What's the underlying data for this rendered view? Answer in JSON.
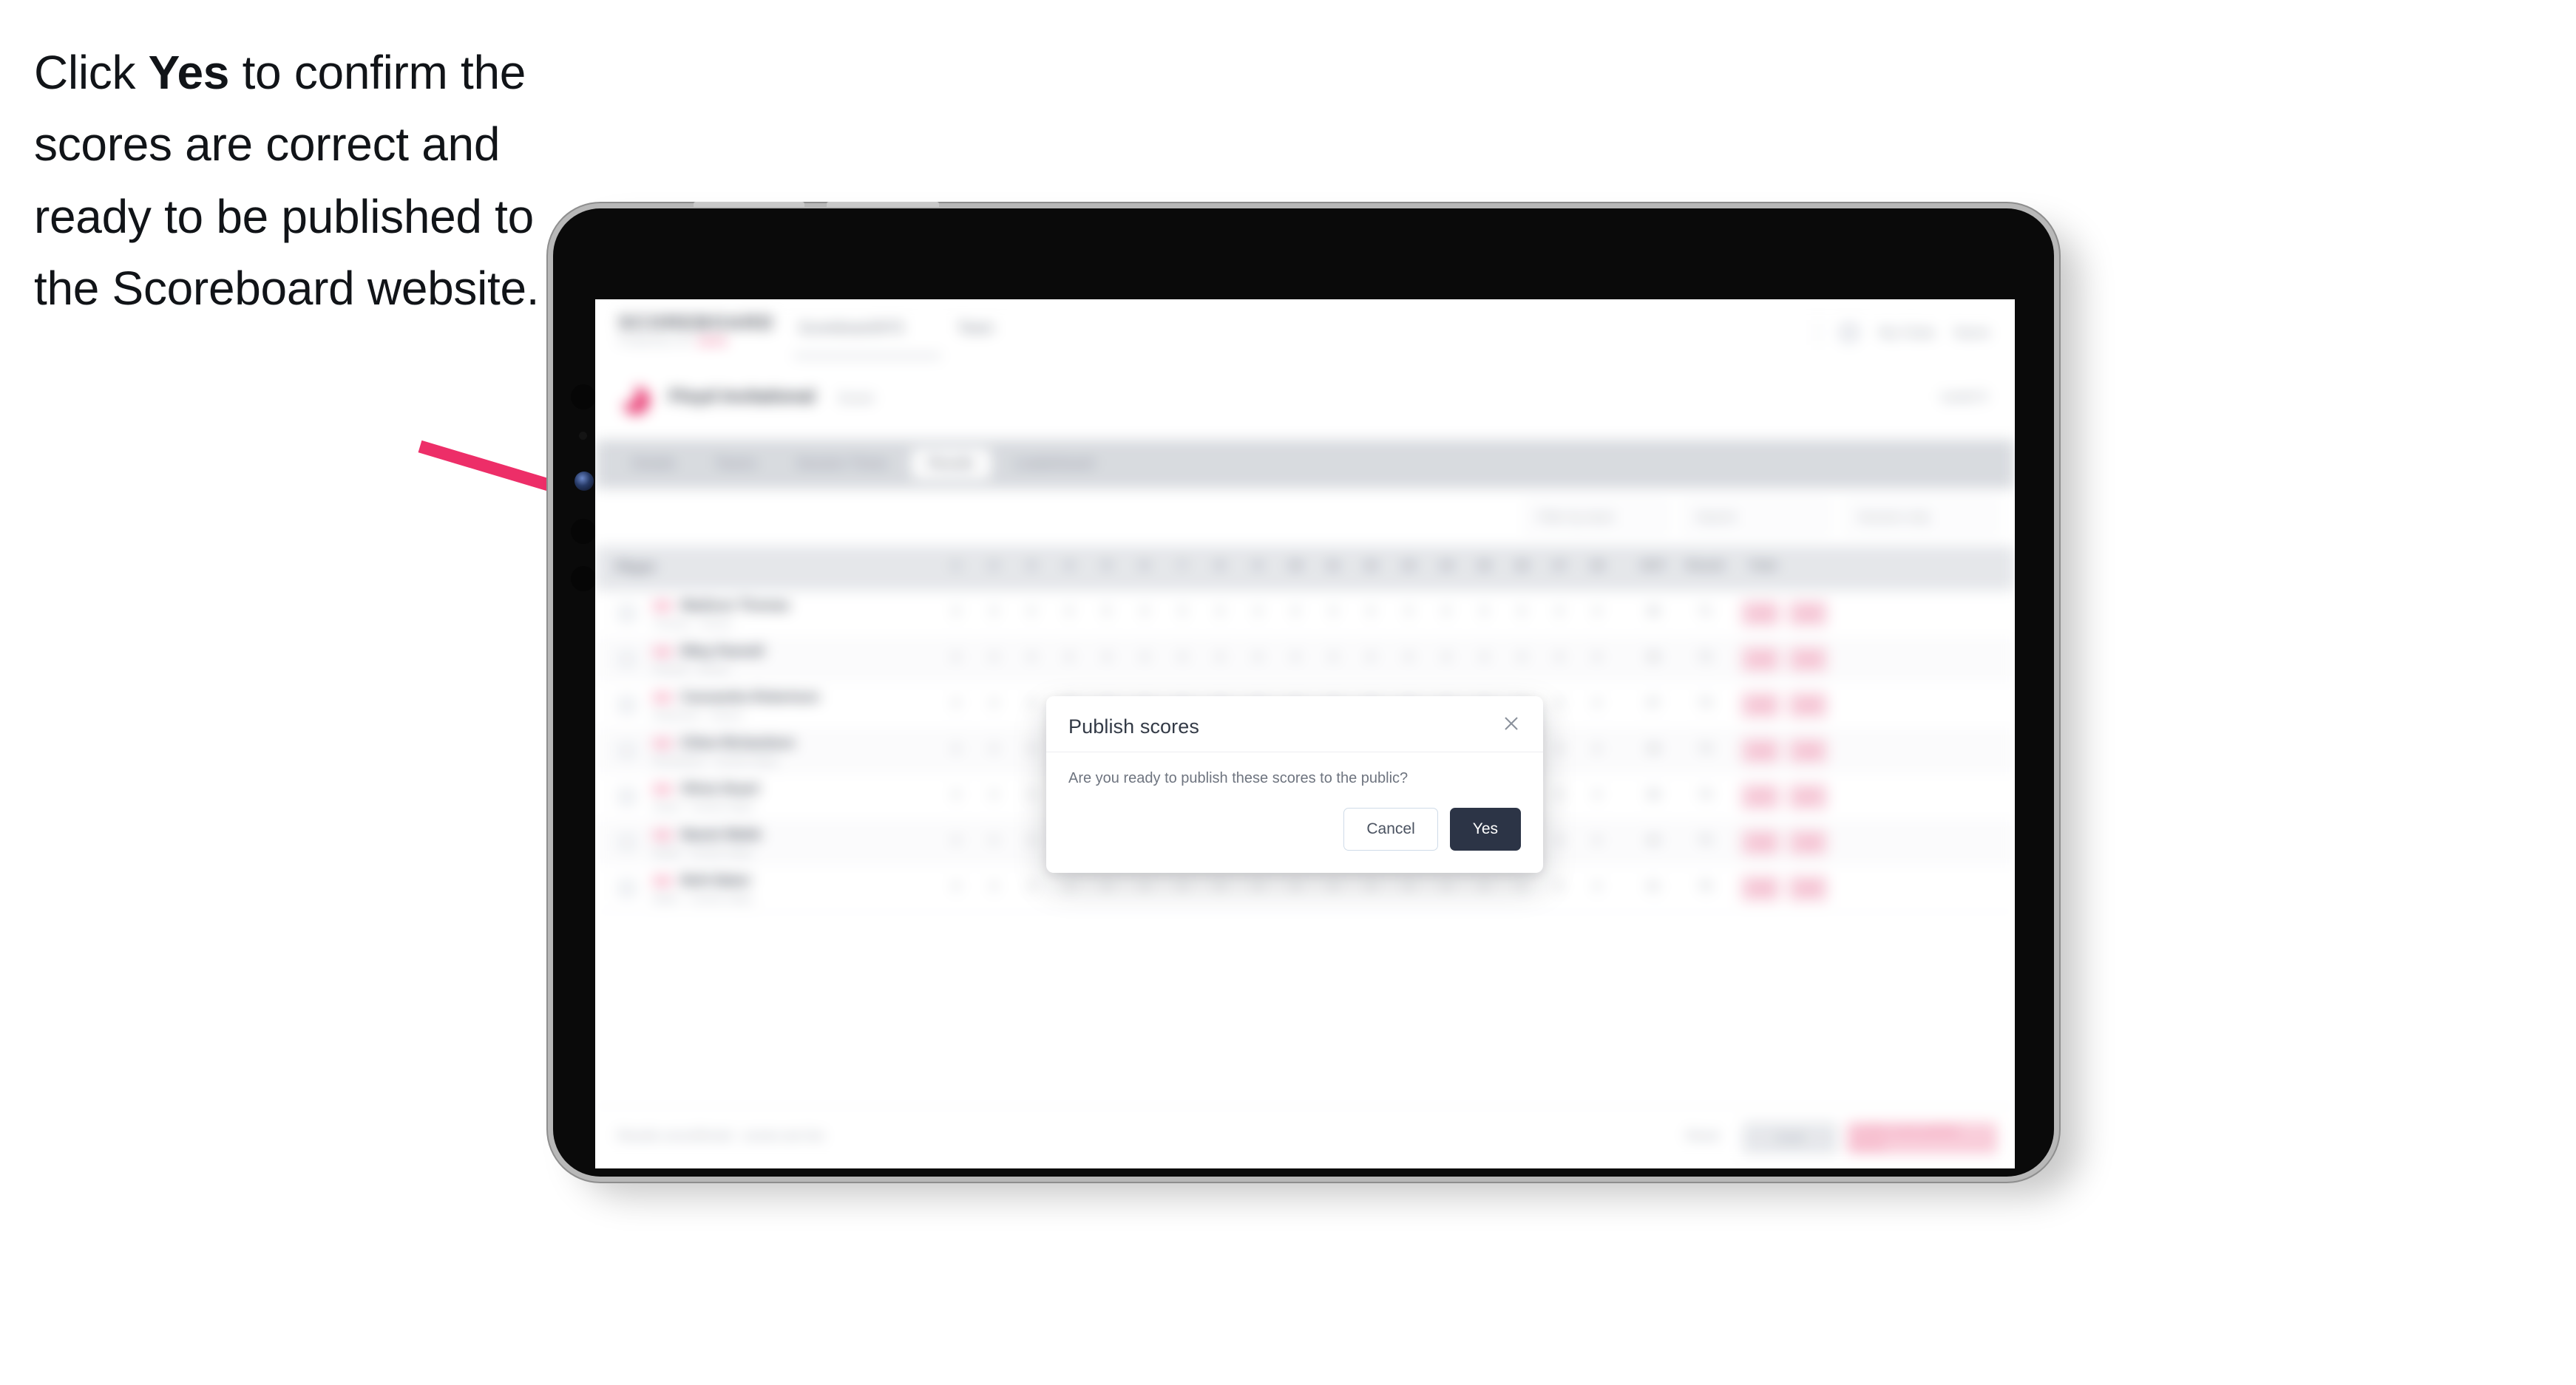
{
  "caption": {
    "lead": "Click ",
    "emphasis": "Yes",
    "rest": " to confirm the scores are correct and ready to be published to the Scoreboard website."
  },
  "annotation": {
    "arrow_color": "#ED2E68",
    "arrow_name": "pointer-arrow"
  },
  "device": {
    "type": "tablet",
    "frame_color": "#0a0a0a",
    "edge_color": "#b8b8b8"
  },
  "app": {
    "header": {
      "brand": "SCOREBOARD",
      "brand_sub_left": "POWERED BY",
      "brand_sub_accent": "SEEN",
      "nav": [
        "Scoreboard/975",
        "Team"
      ],
      "account": [
        "My Clubs",
        "Name"
      ]
    },
    "title_row": {
      "club_name": "Floyd Invitational",
      "tag": "Event",
      "right_meta": "Level 3"
    },
    "tabs": [
      {
        "label": "Details",
        "active": false
      },
      {
        "label": "Teams",
        "active": false
      },
      {
        "label": "Session Times",
        "active": false
      },
      {
        "label": "Results",
        "active": true
      },
      {
        "label": "Leaderboard",
        "active": false
      }
    ],
    "toolbar": {
      "filter": "Filter by team",
      "search": "Search",
      "select": "Session only"
    },
    "table": {
      "headers": [
        "Player",
        "1",
        "2",
        "3",
        "4",
        "5",
        "6",
        "7",
        "8",
        "9",
        "10",
        "11",
        "12",
        "13",
        "14",
        "15",
        "16",
        "17",
        "18",
        "OUT",
        "Round",
        "Total"
      ],
      "rows": [
        {
          "name": "Madison Thomas",
          "sub": "Thomas · School",
          "scores": [
            "4",
            "4",
            "4",
            "4",
            "5",
            "4",
            "3",
            "4",
            "4",
            "4",
            "4",
            "4",
            "3",
            "4",
            "4",
            "4",
            "4",
            "4"
          ],
          "out": "36",
          "round": "71",
          "total_a": "143",
          "total_b": "143"
        },
        {
          "name": "Riley Pannell",
          "sub": "Pannell · School",
          "scores": [
            "4",
            "4",
            "4",
            "4",
            "4",
            "4",
            "4",
            "4",
            "4",
            "4",
            "4",
            "4",
            "4",
            "4",
            "4",
            "4",
            "4",
            "4"
          ],
          "out": "36",
          "round": "72",
          "total_a": "144",
          "total_b": "144"
        },
        {
          "name": "Cassandra Robertson",
          "sub": "Robertson · School",
          "scores": [
            "4",
            "4",
            "4",
            "5",
            "4",
            "4",
            "4",
            "4",
            "4",
            "4",
            "4",
            "4",
            "4",
            "4",
            "4",
            "4",
            "4",
            "4"
          ],
          "out": "37",
          "round": "73",
          "total_a": "145",
          "total_b": "145"
        },
        {
          "name": "Chloe Richardson",
          "sub": "Richardson · Central Valley",
          "scores": [
            "4",
            "4",
            "4",
            "4",
            "4",
            "4",
            "4",
            "5",
            "4",
            "4",
            "4",
            "4",
            "4",
            "4",
            "4",
            "4",
            "4",
            "4"
          ],
          "out": "38",
          "round": "73",
          "total_a": "146",
          "total_b": "146"
        },
        {
          "name": "Olivia Stuart",
          "sub": "Stuart · Central Valley",
          "scores": [
            "4",
            "4",
            "4",
            "4",
            "4",
            "4",
            "4",
            "5",
            "4",
            "4",
            "4",
            "4",
            "4",
            "4",
            "4",
            "4",
            "4",
            "4"
          ],
          "out": "39",
          "round": "74",
          "total_a": "147",
          "total_b": "147"
        },
        {
          "name": "Naomi Webb",
          "sub": "Webb · Central Valley",
          "scores": [
            "4",
            "4",
            "4",
            "4",
            "4",
            "4",
            "4",
            "5",
            "4",
            "4",
            "4",
            "4",
            "4",
            "4",
            "4",
            "4",
            "4",
            "4"
          ],
          "out": "40",
          "round": "75",
          "total_a": "148",
          "total_b": "148"
        },
        {
          "name": "Beth Baker",
          "sub": "Baker · Central Valley",
          "scores": [
            "4",
            "4",
            "4",
            "4",
            "4",
            "4",
            "4",
            "5",
            "4",
            "4",
            "4",
            "4",
            "4",
            "4",
            "4",
            "4",
            "4",
            "4"
          ],
          "out": "41",
          "round": "76",
          "total_a": "149",
          "total_b": "149"
        }
      ]
    },
    "footer": {
      "note": "Results unconfirmed · scores are live",
      "link": "Reset",
      "draft_button": "Draft",
      "publish_button": "Confirm and publish scores"
    }
  },
  "modal": {
    "title": "Publish scores",
    "body": "Are you ready to publish these scores to the public?",
    "cancel_label": "Cancel",
    "confirm_label": "Yes",
    "close_icon": "close-icon",
    "confirm_color": "#2C3446",
    "cancel_border": "#CFDBE8"
  }
}
